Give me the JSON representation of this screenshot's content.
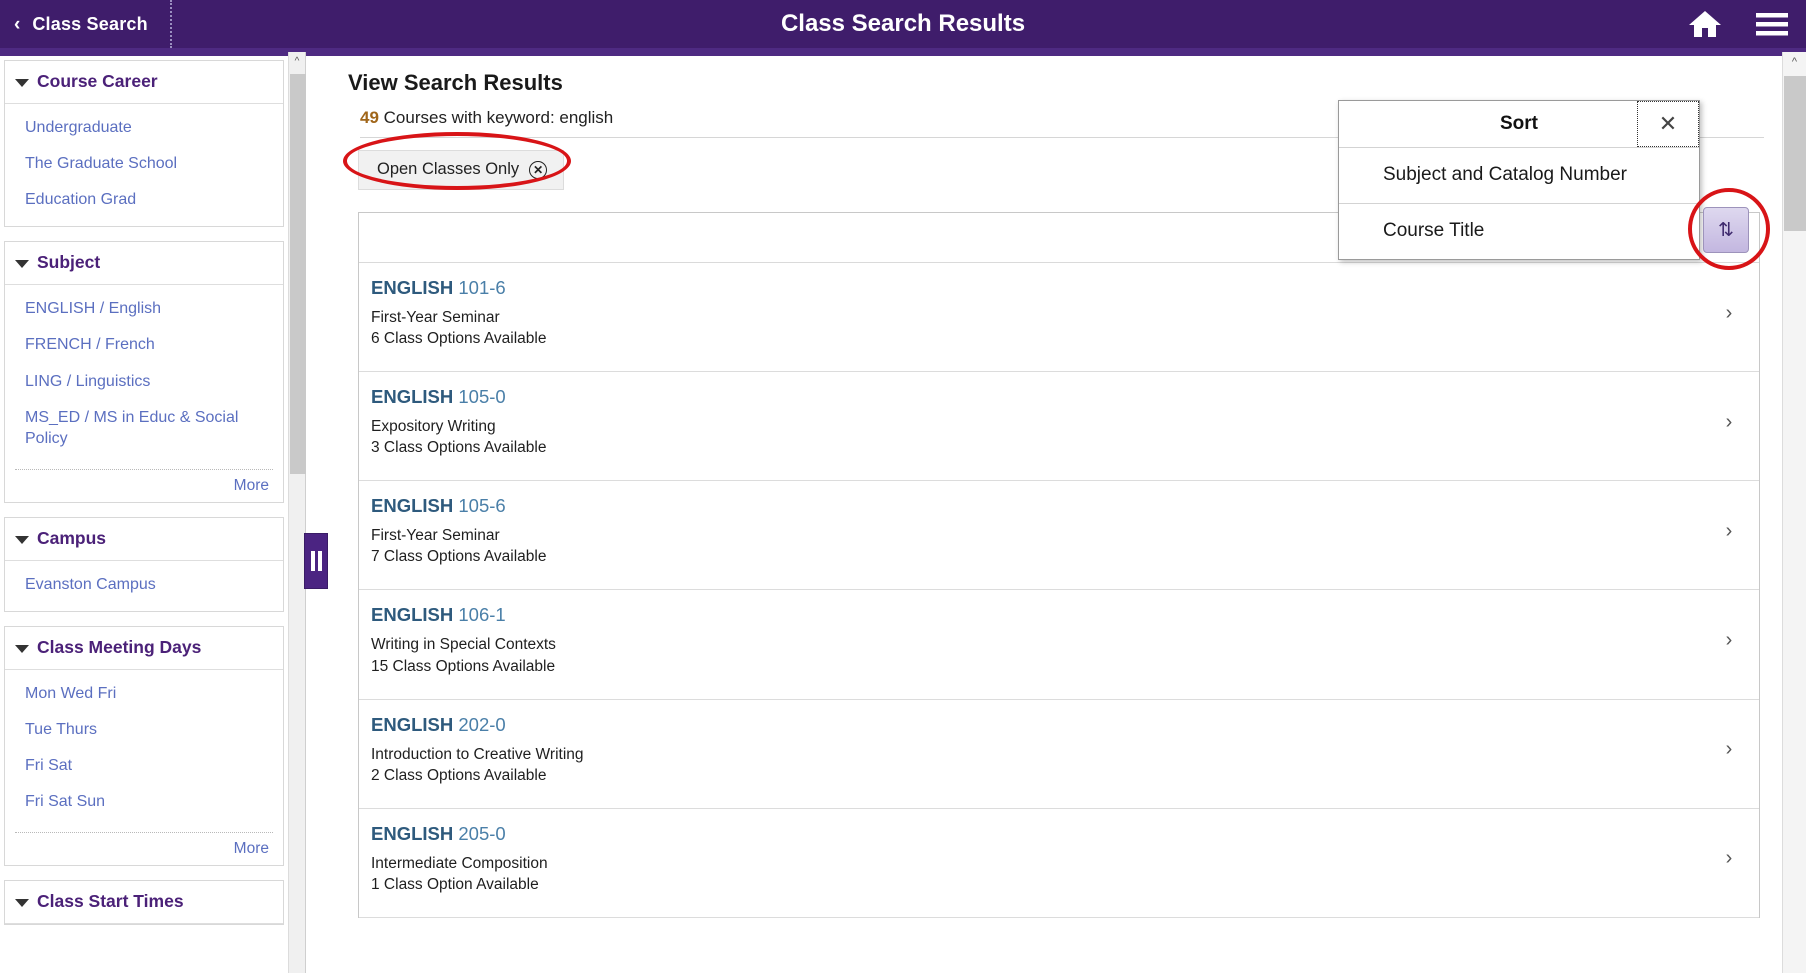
{
  "header": {
    "back_label": "Class Search",
    "back_icon": "chevron-left-icon",
    "title": "Class Search Results",
    "home_icon": "home-icon",
    "menu_icon": "hamburger-menu-icon"
  },
  "sidebar": {
    "facets": [
      {
        "title": "Course Career",
        "items": [
          "Undergraduate",
          "The Graduate School",
          "Education Grad"
        ],
        "more": null
      },
      {
        "title": "Subject",
        "items": [
          "ENGLISH / English",
          "FRENCH / French",
          "LING / Linguistics",
          "MS_ED / MS in Educ & Social Policy"
        ],
        "more": "More"
      },
      {
        "title": "Campus",
        "items": [
          "Evanston Campus"
        ],
        "more": null
      },
      {
        "title": "Class Meeting Days",
        "items": [
          "Mon Wed Fri",
          "Tue Thurs",
          "Fri Sat",
          "Fri Sat Sun"
        ],
        "more": "More"
      },
      {
        "title": "Class Start Times",
        "items": [],
        "more": null
      }
    ],
    "collapse_handle_icon": "pause-bars-collapse-icon",
    "scroll_up_icon": "chevron-up-icon"
  },
  "main": {
    "page_title": "View Search Results",
    "result_count": "49",
    "result_count_text": "Courses with keyword: english",
    "filter_chip": {
      "label": "Open Classes Only",
      "remove_icon": "circle-x-icon"
    },
    "row_chevron_icon": "chevron-right-icon",
    "scroll_up_icon": "chevron-up-icon",
    "courses": [
      {
        "subject": "ENGLISH",
        "number": "101-6",
        "title": "First-Year Seminar",
        "options": "6 Class Options Available"
      },
      {
        "subject": "ENGLISH",
        "number": "105-0",
        "title": "Expository Writing",
        "options": "3 Class Options Available"
      },
      {
        "subject": "ENGLISH",
        "number": "105-6",
        "title": "First-Year Seminar",
        "options": "7 Class Options Available"
      },
      {
        "subject": "ENGLISH",
        "number": "106-1",
        "title": "Writing in Special Contexts",
        "options": "15 Class Options Available"
      },
      {
        "subject": "ENGLISH",
        "number": "202-0",
        "title": "Introduction to Creative Writing",
        "options": "2 Class Options Available"
      },
      {
        "subject": "ENGLISH",
        "number": "205-0",
        "title": "Intermediate Composition",
        "options": "1 Class Option Available"
      }
    ]
  },
  "sort_popup": {
    "title": "Sort",
    "close_icon": "close-x-icon",
    "options": [
      "Subject and Catalog Number",
      "Course Title"
    ]
  },
  "sort_toggle": {
    "icon": "sort-updown-arrows-icon",
    "glyph": "⇅"
  },
  "colors": {
    "header_purple": "#3f1d6b",
    "header_underline": "#4e2a82",
    "facet_title": "#4b2178",
    "link_blue": "#5b6fc0",
    "course_subject": "#2e5a7d",
    "count_orange": "#a0661a",
    "annotation_red": "#d81417"
  }
}
